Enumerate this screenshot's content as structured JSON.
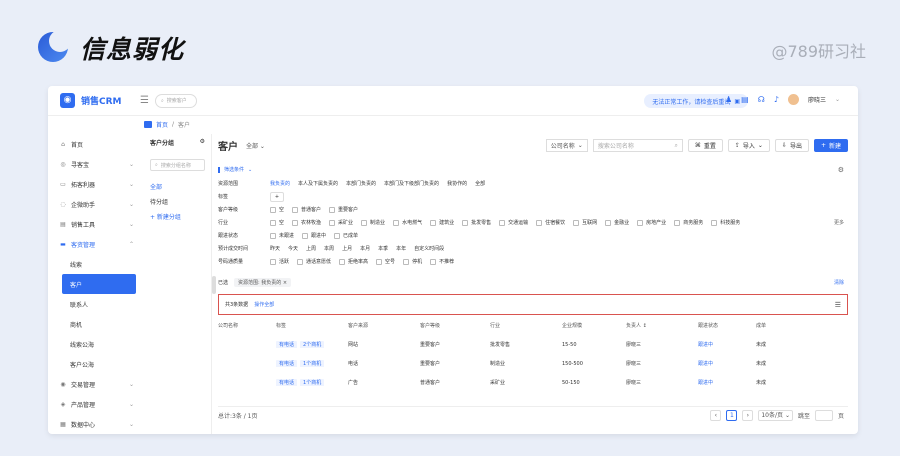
{
  "banner": {
    "title": "信息弱化",
    "watermark": "@789研习社"
  },
  "brand": {
    "name": "销售CRM"
  },
  "topbar": {
    "search_placeholder": "搜索客户",
    "notice": "无法正常工作，请检查后重试",
    "username": "廖晓三"
  },
  "breadcrumb": {
    "home": "首页",
    "current": "客户"
  },
  "sidebar": {
    "items": [
      {
        "label": "首页",
        "icon": "home-icon",
        "glyph": "⌂",
        "caret": false
      },
      {
        "label": "寻客宝",
        "icon": "target-icon",
        "glyph": "◎",
        "caret": true
      },
      {
        "label": "拓客利器",
        "icon": "tool-icon",
        "glyph": "▭",
        "caret": true
      },
      {
        "label": "企微助手",
        "icon": "wechat-icon",
        "glyph": "◌",
        "caret": true
      },
      {
        "label": "销售工具",
        "icon": "toolbox-icon",
        "glyph": "▤",
        "caret": true
      },
      {
        "label": "客资管理",
        "icon": "customer-manage-icon",
        "glyph": "▬",
        "caret": true,
        "open": true
      }
    ],
    "sub_items": [
      "线索",
      "客户",
      "联系人",
      "商机",
      "线索公海",
      "客户公海"
    ],
    "active_sub": "客户",
    "bottom_items": [
      {
        "label": "交易管理",
        "icon": "trade-icon",
        "glyph": "◉"
      },
      {
        "label": "产品管理",
        "icon": "product-icon",
        "glyph": "◈"
      },
      {
        "label": "数据中心",
        "icon": "data-icon",
        "glyph": "▦"
      }
    ]
  },
  "groups": {
    "title": "客户分组",
    "search_placeholder": "搜索分组名称",
    "items": [
      "全部",
      "待分组"
    ],
    "add_label": "+ 新建分组"
  },
  "main": {
    "title": "客户",
    "scope": "全部",
    "search_field": "公司名称",
    "search_placeholder": "搜索公司名称",
    "reset_label": "重置",
    "import_label": "导入",
    "export_label": "导出",
    "new_label": "新建"
  },
  "filters": {
    "header": "筛选条件",
    "rows": [
      {
        "label": "资源范围",
        "type": "text",
        "options": [
          "我负责的",
          "本人及下属负责的",
          "本部门负责的",
          "本部门及下级部门负责的",
          "我协作的",
          "全部"
        ],
        "active": 0
      },
      {
        "label": "标签",
        "type": "plus",
        "options": [
          "+"
        ]
      },
      {
        "label": "客户等级",
        "type": "check",
        "options": [
          "空",
          "普通客户",
          "重要客户"
        ]
      },
      {
        "label": "行业",
        "type": "check",
        "options": [
          "空",
          "农林牧渔",
          "采矿业",
          "制造业",
          "水电燃气",
          "建筑业",
          "批发零售",
          "交通运输",
          "住宿餐饮",
          "互联网",
          "金融业",
          "房地产业",
          "商务服务",
          "科技服务"
        ],
        "more": "更多"
      },
      {
        "label": "跟进状态",
        "type": "check",
        "options": [
          "未跟进",
          "跟进中",
          "已成单"
        ]
      },
      {
        "label": "预计成交时间",
        "type": "text",
        "options": [
          "昨天",
          "今天",
          "上周",
          "本周",
          "上月",
          "本月",
          "本季",
          "本年",
          "自定义时间段"
        ]
      },
      {
        "label": "号码通质量",
        "type": "check",
        "options": [
          "活跃",
          "通话意愿低",
          "拒绝率高",
          "空号",
          "停机",
          "不推荐"
        ]
      }
    ],
    "selected_label": "已选",
    "selected_tag": "资源范围: 我负责的",
    "clear_label": "清除"
  },
  "table": {
    "total_text": "共3条数据",
    "action_link": "操作全部",
    "columns": [
      "公司名称",
      "标签",
      "客户来源",
      "客户等级",
      "行业",
      "企业规模",
      "负责人 ↕",
      "跟进状态",
      "成单"
    ],
    "rows": [
      {
        "company": "",
        "tags": [
          "有电话",
          "2个商机"
        ],
        "source": "网站",
        "level": "重要客户",
        "industry": "批发零售",
        "scale": "15-50",
        "owner": "廖晓三",
        "status": "跟进中",
        "deal": "未成"
      },
      {
        "company": "",
        "tags": [
          "有电话",
          "1个商机"
        ],
        "source": "电话",
        "level": "重要客户",
        "industry": "制造业",
        "scale": "150-500",
        "owner": "廖晓三",
        "status": "跟进中",
        "deal": "未成"
      },
      {
        "company": "",
        "tags": [
          "有电话",
          "1个商机"
        ],
        "source": "广告",
        "level": "普通客户",
        "industry": "采矿业",
        "scale": "50-150",
        "owner": "廖晓三",
        "status": "跟进中",
        "deal": "未成"
      }
    ]
  },
  "footer": {
    "summary": "总计:3条 / 1页",
    "current_page": "1",
    "page_size": "10条/页",
    "goto": "跳至",
    "page_unit": "页"
  }
}
